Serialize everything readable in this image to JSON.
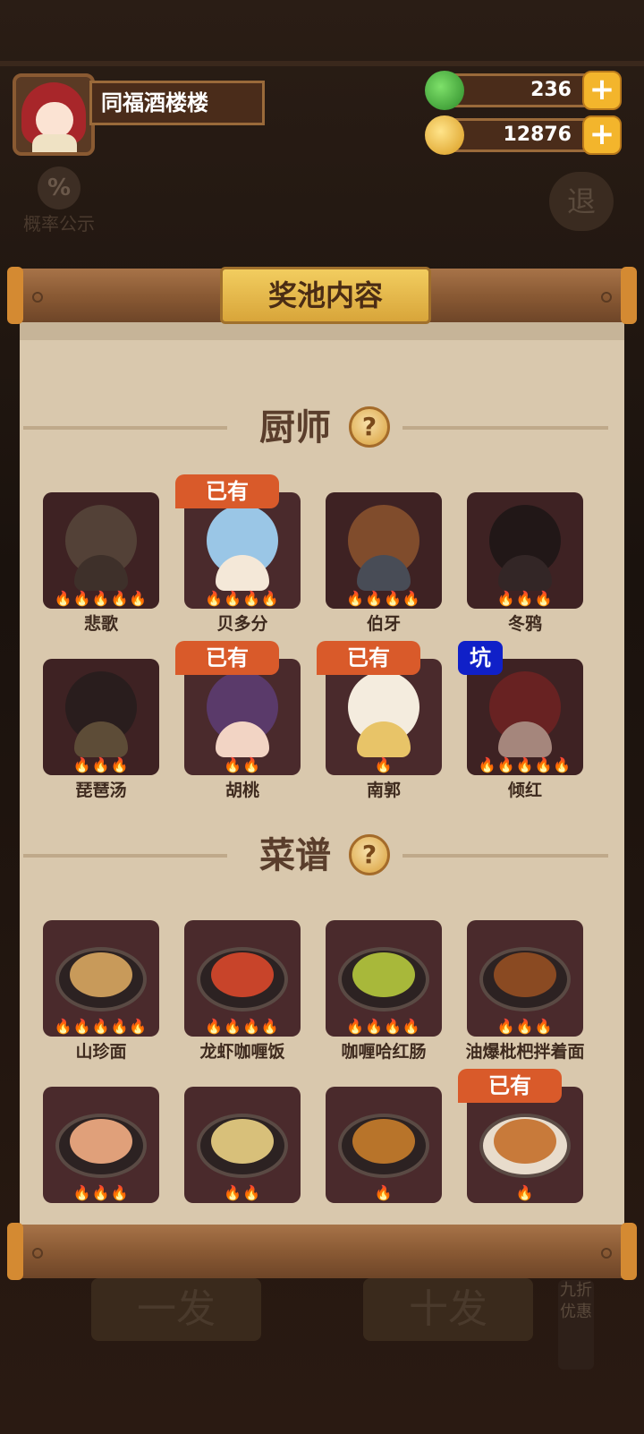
{
  "player": {
    "name": "同福酒楼楼"
  },
  "resources": {
    "jade": "236",
    "coins": "12876",
    "plus": "+"
  },
  "sidebar": {
    "probability_label": "概率公示",
    "probability_icon_text": "%",
    "exit_text": "退"
  },
  "panel": {
    "title": "奖池内容"
  },
  "sections": {
    "chef": {
      "label": "厨师",
      "help": "?"
    },
    "recipe": {
      "label": "菜谱",
      "help": "?"
    }
  },
  "chefs": [
    {
      "name": "悲歌",
      "flames": "🔥🔥🔥🔥🔥",
      "badge": ""
    },
    {
      "name": "贝多分",
      "flames": "🔥🔥🔥🔥",
      "badge": "已有"
    },
    {
      "name": "伯牙",
      "flames": "🔥🔥🔥🔥",
      "badge": ""
    },
    {
      "name": "冬鸦",
      "flames": "🔥🔥🔥",
      "badge": ""
    },
    {
      "name": "琵琶汤",
      "flames": "🔥🔥🔥",
      "badge": ""
    },
    {
      "name": "胡桃",
      "flames": "🔥🔥",
      "badge": "已有"
    },
    {
      "name": "南郭",
      "flames": "🔥",
      "badge": "已有"
    },
    {
      "name": "倾红",
      "flames": "🔥🔥🔥🔥🔥",
      "badge": "坑"
    }
  ],
  "recipes": [
    {
      "name": "山珍面",
      "flames": "🔥🔥🔥🔥🔥",
      "badge": ""
    },
    {
      "name": "龙虾咖喱饭",
      "flames": "🔥🔥🔥🔥",
      "badge": ""
    },
    {
      "name": "咖喱哈红肠",
      "flames": "🔥🔥🔥🔥",
      "badge": ""
    },
    {
      "name": "油爆枇杷拌着面",
      "flames": "🔥🔥🔥",
      "badge": ""
    },
    {
      "name": "",
      "flames": "🔥🔥🔥",
      "badge": ""
    },
    {
      "name": "",
      "flames": "🔥🔥",
      "badge": ""
    },
    {
      "name": "",
      "flames": "🔥",
      "badge": ""
    },
    {
      "name": "",
      "flames": "🔥",
      "badge": "已有"
    }
  ],
  "background": {
    "single_draw": "一发",
    "ten_draw": "十发",
    "discount": "九折优惠"
  },
  "colors": {
    "badge_owned": "#d95a2a",
    "badge_pit": "#1020c8",
    "plate_gold": "#f2cd5f"
  }
}
